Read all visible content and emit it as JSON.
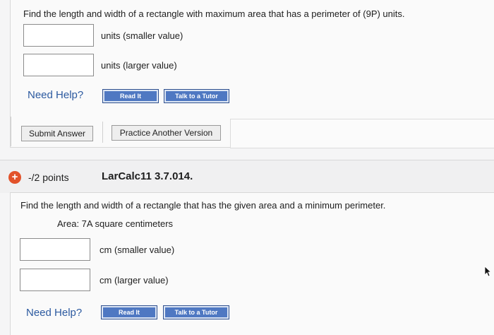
{
  "problem1": {
    "question": "Find the length and width of a rectangle with maximum area that has a perimeter of (9P) units.",
    "answers": [
      {
        "value": "",
        "unit_label": "units (smaller value)"
      },
      {
        "value": "",
        "unit_label": "units (larger value)"
      }
    ],
    "need_help": "Need Help?",
    "read_it": "Read It",
    "talk_to_tutor": "Talk to a Tutor",
    "submit_answer": "Submit Answer",
    "practice_another": "Practice Another Version"
  },
  "problem2": {
    "points": "-/2 points",
    "problem_id": "LarCalc11 3.7.014.",
    "question": "Find the length and width of a rectangle that has the given area and a minimum perimeter.",
    "area_line": "Area: 7A square centimeters",
    "answers": [
      {
        "value": "",
        "unit_label": "cm (smaller value)"
      },
      {
        "value": "",
        "unit_label": "cm (larger value)"
      }
    ],
    "need_help": "Need Help?",
    "read_it": "Read It",
    "talk_to_tutor": "Talk to a Tutor"
  },
  "icons": {
    "expand": "plus-circle-icon",
    "cursor": "mouse-pointer-icon"
  },
  "colors": {
    "accent_blue": "#2c5aa0",
    "button_blue": "#4f78c2",
    "expand_orange": "#e2522a"
  }
}
